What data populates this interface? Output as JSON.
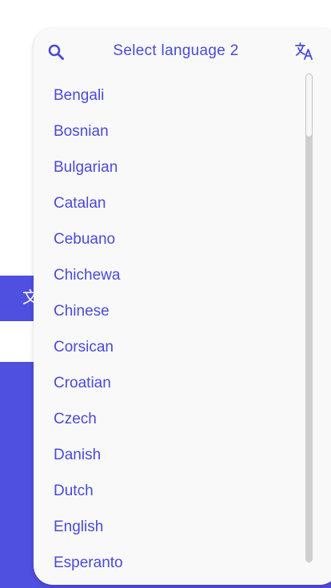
{
  "colors": {
    "accent": "#4f4fe0",
    "text": "#4a4ad9",
    "dropdown_bg": "#f9f9f9",
    "scrollbar_track": "#cfcfcf"
  },
  "background": {
    "button_icon": "文"
  },
  "dropdown": {
    "title": "Select language 2",
    "left_icon": "search-icon",
    "right_icon": "translate-icon",
    "items": [
      "Bengali",
      "Bosnian",
      "Bulgarian",
      "Catalan",
      "Cebuano",
      "Chichewa",
      "Chinese",
      "Corsican",
      "Croatian",
      "Czech",
      "Danish",
      "Dutch",
      "English",
      "Esperanto"
    ]
  }
}
